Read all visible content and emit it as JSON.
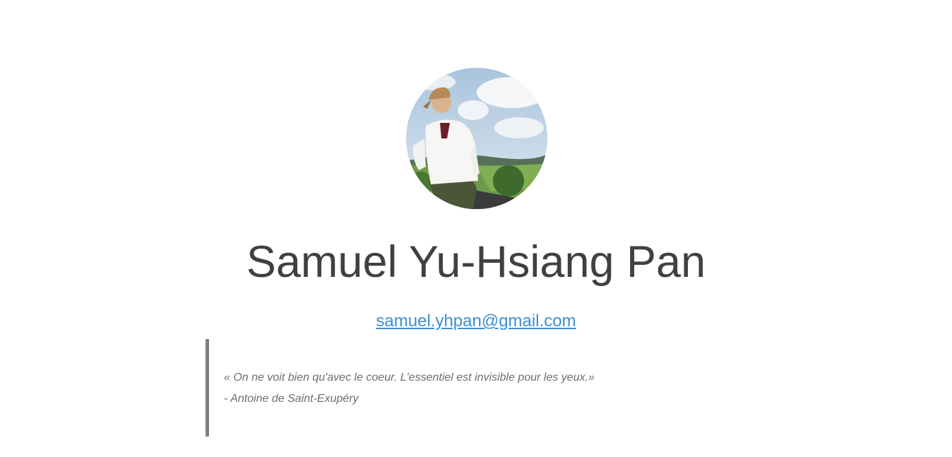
{
  "profile": {
    "name": "Samuel Yu-Hsiang Pan",
    "email": "samuel.yhpan@gmail.com",
    "email_href": "mailto:samuel.yhpan@gmail.com",
    "photo_alt": "Samuel Yu-Hsiang Pan"
  },
  "quote": {
    "text": "« On ne voit bien qu'avec le coeur. L'essentiel est invisible pour les yeux.»",
    "author": "- Antoine de Saint-Exupéry"
  },
  "colors": {
    "heading": "#404040",
    "link": "#3d8fd1",
    "quote_text": "#6e6e6e",
    "quote_border": "#7f7f7f"
  }
}
